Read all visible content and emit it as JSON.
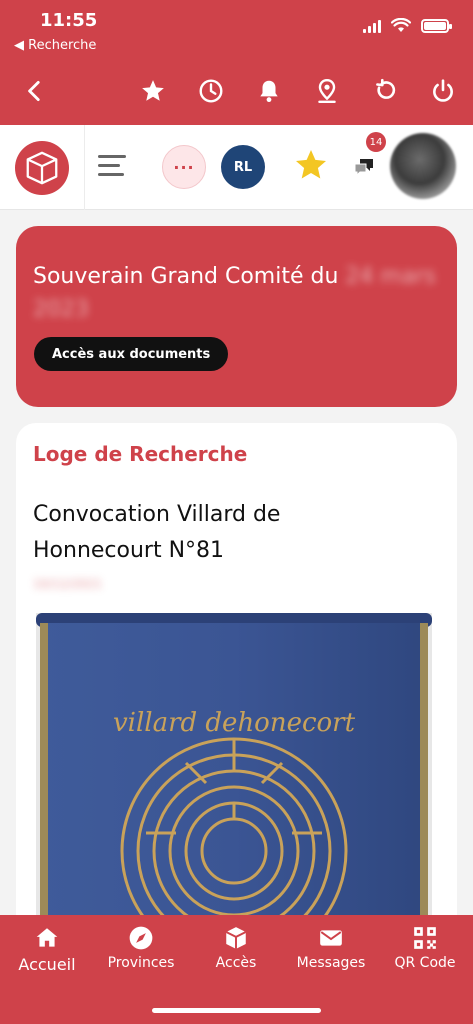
{
  "status": {
    "time": "11:55",
    "back": "◀ Recherche"
  },
  "toolbar": {
    "icons": [
      "chevron-left-icon",
      "star-icon",
      "clock-icon",
      "bell-icon",
      "location-icon",
      "refresh-icon",
      "power-icon"
    ]
  },
  "appbar": {
    "more_label": "···",
    "rl_label": "RL",
    "chat_badge": "14"
  },
  "banner": {
    "title": "Souverain Grand Comité du",
    "title_blurred_suffix": "24 mars 2023",
    "button": "Accès aux documents"
  },
  "card": {
    "label": "Loge de Recherche",
    "title": "Convocation Villard de Honnecourt N°81",
    "date": "10/12/2021",
    "image_text": "villard dehonecort"
  },
  "tabs": [
    {
      "label": "Accueil",
      "icon": "home-icon"
    },
    {
      "label": "Provinces",
      "icon": "compass-icon"
    },
    {
      "label": "Accès",
      "icon": "box-icon"
    },
    {
      "label": "Messages",
      "icon": "mail-icon"
    },
    {
      "label": "QR Code",
      "icon": "qr-code-icon"
    }
  ],
  "colors": {
    "brand_red": "#cf424a",
    "banner_blue": "#34508f",
    "gold": "#c9a25a"
  }
}
